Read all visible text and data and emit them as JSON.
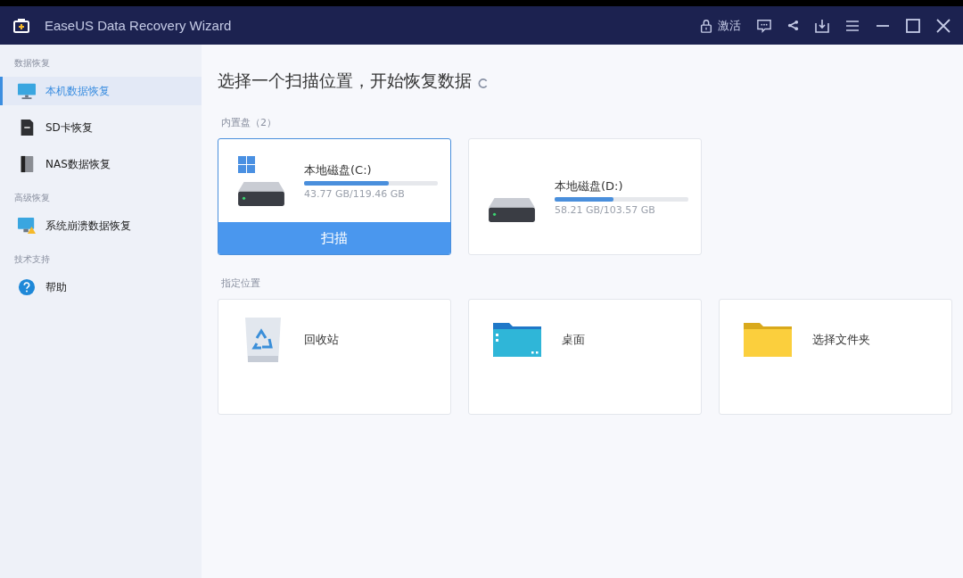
{
  "window": {
    "title": "EaseUS Data Recovery Wizard",
    "activate": "激活"
  },
  "sidebar": {
    "sections": [
      {
        "heading": "数据恢复",
        "items": [
          {
            "label": "本机数据恢复",
            "kind": "monitor",
            "selected": true
          },
          {
            "label": "SD卡恢复",
            "kind": "sd",
            "selected": false
          },
          {
            "label": "NAS数据恢复",
            "kind": "nas",
            "selected": false
          }
        ]
      },
      {
        "heading": "高级恢复",
        "items": [
          {
            "label": "系统崩溃数据恢复",
            "kind": "crash",
            "selected": false
          }
        ]
      },
      {
        "heading": "技术支持",
        "items": [
          {
            "label": "帮助",
            "kind": "help",
            "selected": false
          }
        ]
      }
    ]
  },
  "main": {
    "title": "选择一个扫描位置，开始恢复数据",
    "drives_heading": "内置盘（2）",
    "drives": [
      {
        "name": "本地磁盘(C:)",
        "size": "43.77 GB/119.46 GB",
        "level": 0.63,
        "system": true,
        "selected": true,
        "action": "扫描"
      },
      {
        "name": "本地磁盘(D:)",
        "size": "58.21 GB/103.57 GB",
        "level": 0.44,
        "system": false,
        "selected": false
      }
    ],
    "locations_heading": "指定位置",
    "locations": [
      {
        "label": "回收站",
        "kind": "recycle"
      },
      {
        "label": "桌面",
        "kind": "desktop"
      },
      {
        "label": "选择文件夹",
        "kind": "folder"
      }
    ]
  }
}
